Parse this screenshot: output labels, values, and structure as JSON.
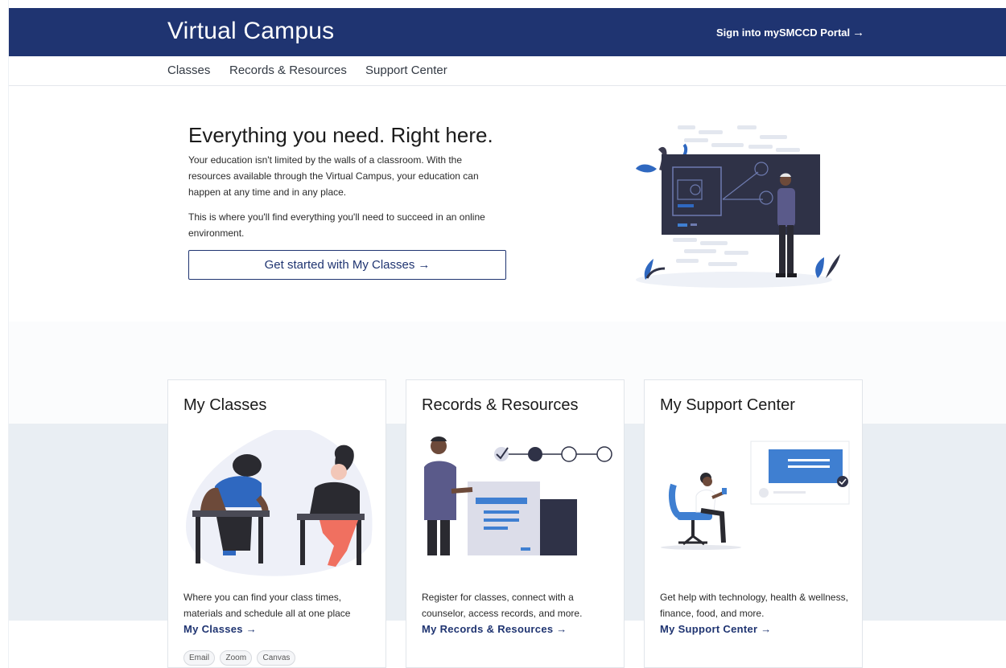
{
  "header": {
    "title": "Virtual Campus",
    "portal_link": "Sign into mySMCCD Portal",
    "portal_arrow": "→"
  },
  "subnav": {
    "items": [
      "Classes",
      "Records & Resources",
      "Support Center"
    ]
  },
  "hero": {
    "heading": "Everything you need. Right here.",
    "paragraph1": "Your education isn't limited by the walls of a classroom. With the resources available through the Virtual Campus, your education can happen at any time and in any place.",
    "paragraph2": "This is where you'll find everything you'll need to succeed in an online environment.",
    "cta_label": "Get started with My Classes",
    "cta_arrow": "→"
  },
  "cards": [
    {
      "title": "My Classes",
      "description": "Where you can find your class times, materials and schedule all at one place",
      "link": "My Classes →",
      "tags": [
        "Email",
        "Zoom",
        "Canvas"
      ]
    },
    {
      "title": "Records & Resources",
      "description": "Register for classes, connect with a counselor, access records, and more.",
      "link": "My Records & Resources →"
    },
    {
      "title": "My Support Center",
      "description": "Get help with technology, health & wellness, finance, food, and more.",
      "link": "My Support Center →"
    }
  ],
  "colors": {
    "brand": "#1f3471",
    "accent": "#3f7fd1",
    "band": "#e9eef3"
  }
}
